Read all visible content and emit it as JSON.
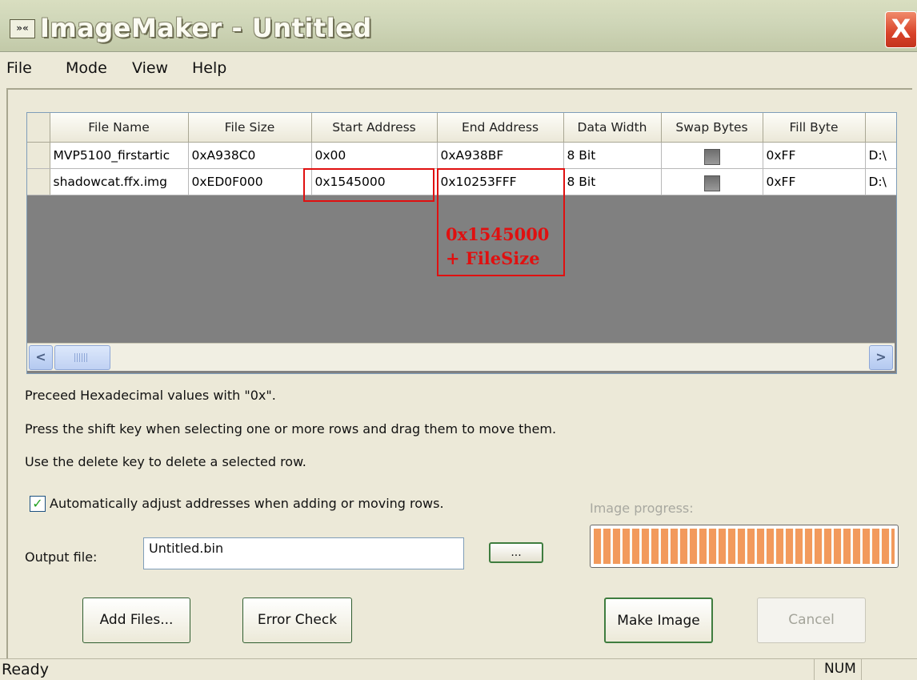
{
  "window": {
    "title": "ImageMaker - Untitled",
    "icon": "app-icon",
    "close_label": "X"
  },
  "menu": {
    "items": [
      {
        "label": "File"
      },
      {
        "label": "Mode"
      },
      {
        "label": "View"
      },
      {
        "label": "Help"
      }
    ]
  },
  "table": {
    "columns": [
      "File Name",
      "File Size",
      "Start Address",
      "End Address",
      "Data Width",
      "Swap Bytes",
      "Fill Byte",
      ""
    ],
    "rows": [
      {
        "file_name": "MVP5100_firstartic",
        "file_size": "0xA938C0",
        "start_address": "0x00",
        "end_address": "0xA938BF",
        "data_width": "8 Bit",
        "swap_bytes": false,
        "fill_byte": "0xFF",
        "path": "D:\\"
      },
      {
        "file_name": "shadowcat.ffx.img",
        "file_size": "0xED0F000",
        "start_address": "0x1545000",
        "end_address": "0x10253FFF",
        "data_width": "8 Bit",
        "swap_bytes": false,
        "fill_byte": "0xFF",
        "path": "D:\\"
      }
    ]
  },
  "annotation": {
    "line1": "0x1545000",
    "line2": "+ FileSize",
    "color": "#e01010"
  },
  "info": {
    "line1": "Preceed Hexadecimal values with \"0x\".",
    "line2": "Press the shift key when selecting one or more rows and drag them to move them.",
    "line3": "Use the delete key to delete a selected row."
  },
  "options": {
    "auto_adjust_label": "Automatically adjust addresses when adding or moving rows.",
    "auto_adjust_checked": true
  },
  "progress": {
    "label": "Image progress:",
    "value_percent": 100,
    "color": "#f29a5c"
  },
  "output": {
    "label": "Output file:",
    "value": "Untitled.bin",
    "browse_label": "..."
  },
  "buttons": {
    "add_files": "Add Files...",
    "error_check": "Error Check",
    "make_image": "Make Image",
    "cancel": "Cancel"
  },
  "status": {
    "text": "Ready",
    "num": "NUM"
  }
}
